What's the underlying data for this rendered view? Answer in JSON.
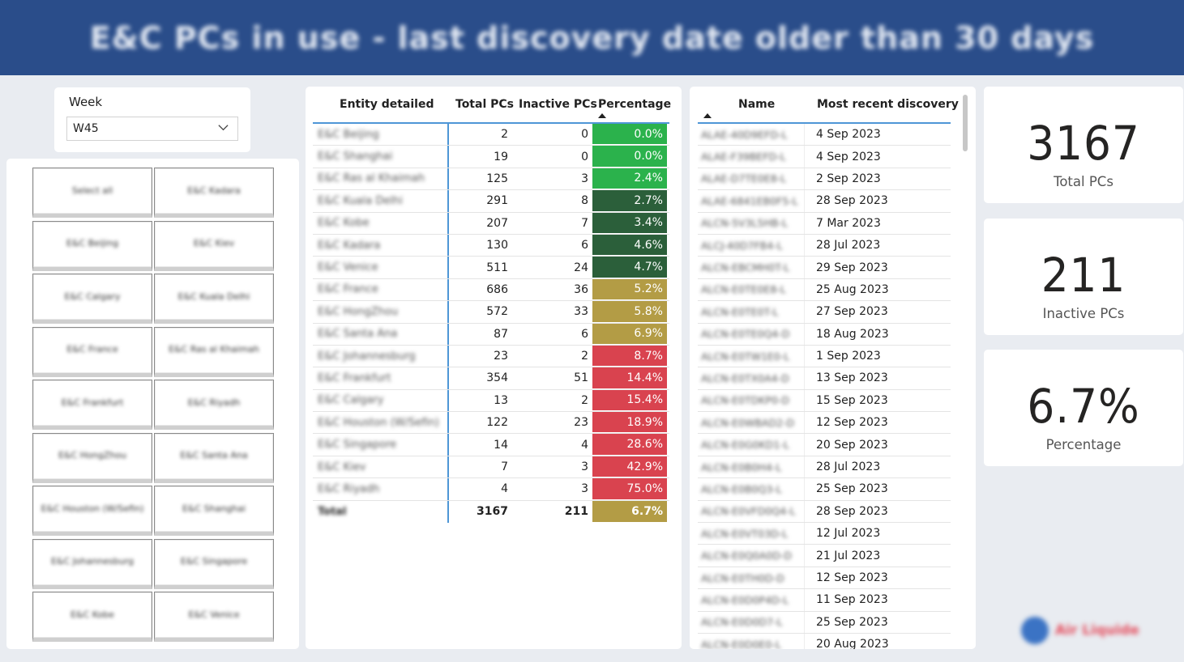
{
  "header": {
    "title": "E&C PCs in use - last discovery date older than 30 days"
  },
  "week_slicer": {
    "label": "Week",
    "selected": "W45"
  },
  "buttons": [
    "Select all",
    "E&C Kadara",
    "E&C Beijing",
    "E&C Kiev",
    "E&C Calgary",
    "E&C Kuala Delhi",
    "E&C France",
    "E&C Ras al Khaimah",
    "E&C Frankfurt",
    "E&C Riyadh",
    "E&C HongZhou",
    "E&C Santa Ana",
    "E&C Houston (W/Sefin)",
    "E&C Shanghai",
    "E&C Johannesburg",
    "E&C Singapore",
    "E&C Kobe",
    "E&C Venice"
  ],
  "entity_table": {
    "headers": {
      "entity": "Entity detailed",
      "total": "Total PCs",
      "inactive": "Inactive PCs",
      "pct": "Percentage"
    },
    "rows": [
      {
        "entity": "E&C Beijing",
        "total": "2",
        "inactive": "0",
        "pct": "0.0%",
        "color": "#2bb24c"
      },
      {
        "entity": "E&C Shanghai",
        "total": "19",
        "inactive": "0",
        "pct": "0.0%",
        "color": "#2bb24c"
      },
      {
        "entity": "E&C Ras al Khaimah",
        "total": "125",
        "inactive": "3",
        "pct": "2.4%",
        "color": "#2bb24c"
      },
      {
        "entity": "E&C Kuala Delhi",
        "total": "291",
        "inactive": "8",
        "pct": "2.7%",
        "color": "#2b5f3a"
      },
      {
        "entity": "E&C Kobe",
        "total": "207",
        "inactive": "7",
        "pct": "3.4%",
        "color": "#2b5f3a"
      },
      {
        "entity": "E&C Kadara",
        "total": "130",
        "inactive": "6",
        "pct": "4.6%",
        "color": "#2b5f3a"
      },
      {
        "entity": "E&C Venice",
        "total": "511",
        "inactive": "24",
        "pct": "4.7%",
        "color": "#2b5f3a"
      },
      {
        "entity": "E&C France",
        "total": "686",
        "inactive": "36",
        "pct": "5.2%",
        "color": "#b39c45"
      },
      {
        "entity": "E&C HongZhou",
        "total": "572",
        "inactive": "33",
        "pct": "5.8%",
        "color": "#b39c45"
      },
      {
        "entity": "E&C Santa Ana",
        "total": "87",
        "inactive": "6",
        "pct": "6.9%",
        "color": "#b39c45"
      },
      {
        "entity": "E&C Johannesburg",
        "total": "23",
        "inactive": "2",
        "pct": "8.7%",
        "color": "#d9434f"
      },
      {
        "entity": "E&C Frankfurt",
        "total": "354",
        "inactive": "51",
        "pct": "14.4%",
        "color": "#d9434f"
      },
      {
        "entity": "E&C Calgary",
        "total": "13",
        "inactive": "2",
        "pct": "15.4%",
        "color": "#d9434f"
      },
      {
        "entity": "E&C Houston (W/Sefin)",
        "total": "122",
        "inactive": "23",
        "pct": "18.9%",
        "color": "#d9434f"
      },
      {
        "entity": "E&C Singapore",
        "total": "14",
        "inactive": "4",
        "pct": "28.6%",
        "color": "#d9434f"
      },
      {
        "entity": "E&C Kiev",
        "total": "7",
        "inactive": "3",
        "pct": "42.9%",
        "color": "#d9434f"
      },
      {
        "entity": "E&C Riyadh",
        "total": "4",
        "inactive": "3",
        "pct": "75.0%",
        "color": "#d9434f"
      }
    ],
    "total_row": {
      "entity": "Total",
      "total": "3167",
      "inactive": "211",
      "pct": "6.7%",
      "color": "#b39c45"
    }
  },
  "names_table": {
    "headers": {
      "name": "Name",
      "discovery": "Most recent discovery"
    },
    "rows": [
      {
        "name": "ALAE-40D9EFD-L",
        "date": "4 Sep 2023"
      },
      {
        "name": "ALAE-F39BEFD-L",
        "date": "4 Sep 2023"
      },
      {
        "name": "ALAE-D7TE0E8-L",
        "date": "2 Sep 2023"
      },
      {
        "name": "ALAE-6841EB0F5-L",
        "date": "28 Sep 2023"
      },
      {
        "name": "ALCN-5V3L5HB-L",
        "date": "7 Mar 2023"
      },
      {
        "name": "ALCJ-40D7FB4-L",
        "date": "28 Jul 2023"
      },
      {
        "name": "ALCN-EBCMH0T-L",
        "date": "29 Sep 2023"
      },
      {
        "name": "ALCN-E0TE0E8-L",
        "date": "25 Aug 2023"
      },
      {
        "name": "ALCN-E0TE0T-L",
        "date": "27 Sep 2023"
      },
      {
        "name": "ALCN-E0TE0Q4-D",
        "date": "18 Aug 2023"
      },
      {
        "name": "ALCN-E0TW1E0-L",
        "date": "1 Sep 2023"
      },
      {
        "name": "ALCN-E0TX0A4-D",
        "date": "13 Sep 2023"
      },
      {
        "name": "ALCN-E0TDKP0-D",
        "date": "15 Sep 2023"
      },
      {
        "name": "ALCN-E0WBAD2-D",
        "date": "12 Sep 2023"
      },
      {
        "name": "ALCN-E0G0KD1-L",
        "date": "20 Sep 2023"
      },
      {
        "name": "ALCN-E0B0H4-L",
        "date": "28 Jul 2023"
      },
      {
        "name": "ALCN-E0B0Q3-L",
        "date": "25 Sep 2023"
      },
      {
        "name": "ALCN-E0VFD0Q4-L",
        "date": "28 Sep 2023"
      },
      {
        "name": "ALCN-E0VT03D-L",
        "date": "12 Jul 2023"
      },
      {
        "name": "ALCN-E0Q0A0D-D",
        "date": "21 Jul 2023"
      },
      {
        "name": "ALCN-E0TH0D-D",
        "date": "12 Sep 2023"
      },
      {
        "name": "ALCN-E0D0P4D-L",
        "date": "11 Sep 2023"
      },
      {
        "name": "ALCN-E0D0D7-L",
        "date": "25 Sep 2023"
      },
      {
        "name": "ALCN-E0D0E0-L",
        "date": "20 Aug 2023"
      }
    ]
  },
  "kpis": [
    {
      "value": "3167",
      "label": "Total PCs"
    },
    {
      "value": "211",
      "label": "Inactive PCs"
    },
    {
      "value": "6.7%",
      "label": "Percentage"
    }
  ],
  "logo": {
    "text": "Air Liquide"
  }
}
